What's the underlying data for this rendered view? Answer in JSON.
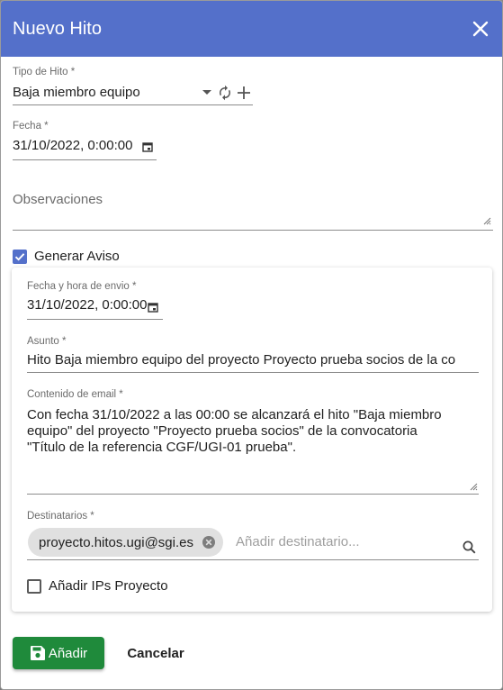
{
  "dialog": {
    "title": "Nuevo Hito"
  },
  "form": {
    "tipo_hito": {
      "label": "Tipo de Hito *",
      "value": "Baja miembro equipo"
    },
    "fecha": {
      "label": "Fecha *",
      "value": "31/10/2022, 0:00:00"
    },
    "observaciones": {
      "label": "Observaciones",
      "value": ""
    },
    "generar_aviso": {
      "label": "Generar Aviso",
      "checked": true
    }
  },
  "aviso": {
    "fecha_envio": {
      "label": "Fecha y hora de envio *",
      "value": "31/10/2022, 0:00:00"
    },
    "asunto": {
      "label": "Asunto *",
      "value": "Hito Baja miembro equipo del proyecto Proyecto prueba socios de la co"
    },
    "contenido": {
      "label": "Contenido de email *",
      "lines": [
        "Con fecha 31/10/2022 a las 00:00 se alcanzará el hito \"Baja miembro",
        "equipo\" del proyecto \"Proyecto prueba socios\" de la convocatoria",
        "\"Título de la referencia CGF/UGI-01 prueba\"."
      ]
    },
    "destinatarios": {
      "label": "Destinatarios *",
      "chips": [
        "proyecto.hitos.ugi@sgi.es"
      ],
      "placeholder": "Añadir destinatario..."
    },
    "anadir_ips": {
      "label": "Añadir IPs Proyecto",
      "checked": false
    }
  },
  "actions": {
    "add_label": "Añadir",
    "cancel_label": "Cancelar"
  },
  "colors": {
    "header": "#5470ca",
    "primary_button": "#1f8a3b",
    "checkbox_checked": "#5470ca"
  },
  "icons": {
    "close": "close-icon",
    "dropdown": "arrow-drop-down-icon",
    "refresh": "refresh-icon",
    "add": "plus-icon",
    "calendar": "calendar-icon",
    "resize": "resize-handle-icon",
    "search": "search-icon",
    "chip_remove": "cancel-circle-icon",
    "save": "save-icon",
    "check": "check-icon"
  }
}
